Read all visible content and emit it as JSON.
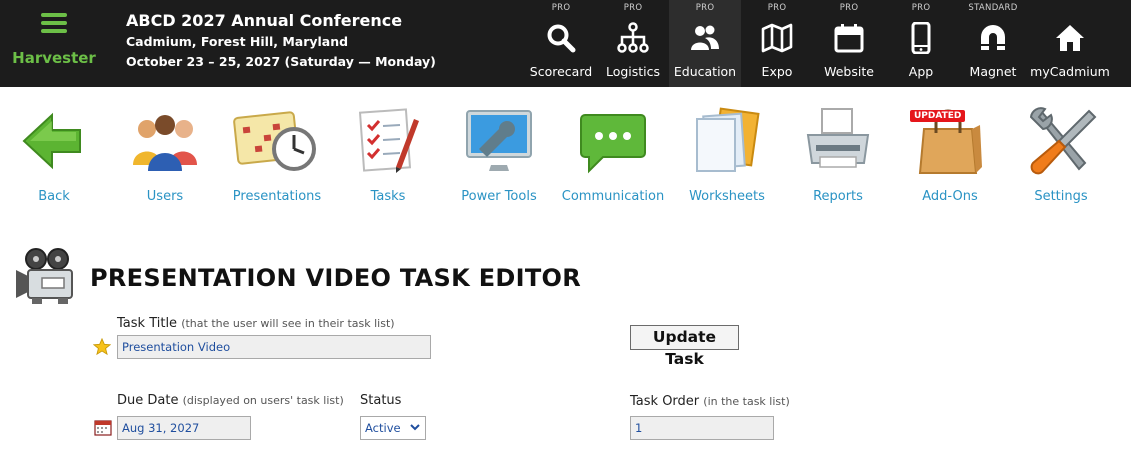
{
  "brand": {
    "name": "Harvester"
  },
  "event": {
    "title": "ABCD 2027 Annual Conference",
    "location": "Cadmium, Forest Hill, Maryland",
    "dates": "October 23 – 25, 2027 (Saturday — Monday)"
  },
  "nav": [
    {
      "tier": "PRO",
      "label": "Scorecard",
      "icon": "search-icon"
    },
    {
      "tier": "PRO",
      "label": "Logistics",
      "icon": "sitemap-icon"
    },
    {
      "tier": "PRO",
      "label": "Education",
      "icon": "users-icon",
      "active": true
    },
    {
      "tier": "PRO",
      "label": "Expo",
      "icon": "map-icon"
    },
    {
      "tier": "PRO",
      "label": "Website",
      "icon": "calendar-icon"
    },
    {
      "tier": "PRO",
      "label": "App",
      "icon": "mobile-icon"
    },
    {
      "tier": "STANDARD",
      "label": "Magnet",
      "icon": "magnet-icon"
    },
    {
      "tier": "",
      "label": "myCadmium",
      "icon": "home-icon"
    }
  ],
  "tools": [
    {
      "label": "Back",
      "icon": "back-arrow-icon"
    },
    {
      "label": "Users",
      "icon": "users-group-icon"
    },
    {
      "label": "Presentations",
      "icon": "calendar-clock-icon"
    },
    {
      "label": "Tasks",
      "icon": "checklist-icon"
    },
    {
      "label": "Power Tools",
      "icon": "monitor-wrench-icon"
    },
    {
      "label": "Communication",
      "icon": "chat-bubble-icon"
    },
    {
      "label": "Worksheets",
      "icon": "documents-icon"
    },
    {
      "label": "Reports",
      "icon": "printer-icon"
    },
    {
      "label": "Add-Ons",
      "icon": "shopping-bag-icon",
      "badge": "UPDATED"
    },
    {
      "label": "Settings",
      "icon": "wrench-screwdriver-icon"
    }
  ],
  "editor": {
    "title": "PRESENTATION VIDEO TASK EDITOR",
    "task_title_label": "Task Title",
    "task_title_hint": "(that the user will see in their task list)",
    "task_title_value": "Presentation Video",
    "update_button": "Update Task",
    "due_date_label": "Due Date",
    "due_date_hint": "(displayed on users' task list)",
    "due_date_value": "Aug 31, 2027",
    "status_label": "Status",
    "status_value": "Active",
    "task_order_label": "Task Order",
    "task_order_hint": "(in the task list)",
    "task_order_value": "1"
  },
  "colors": {
    "topbar": "#1c1c1c",
    "brand_green": "#6cbf47",
    "link_blue": "#2a93c4",
    "badge_red": "#e5161b"
  }
}
